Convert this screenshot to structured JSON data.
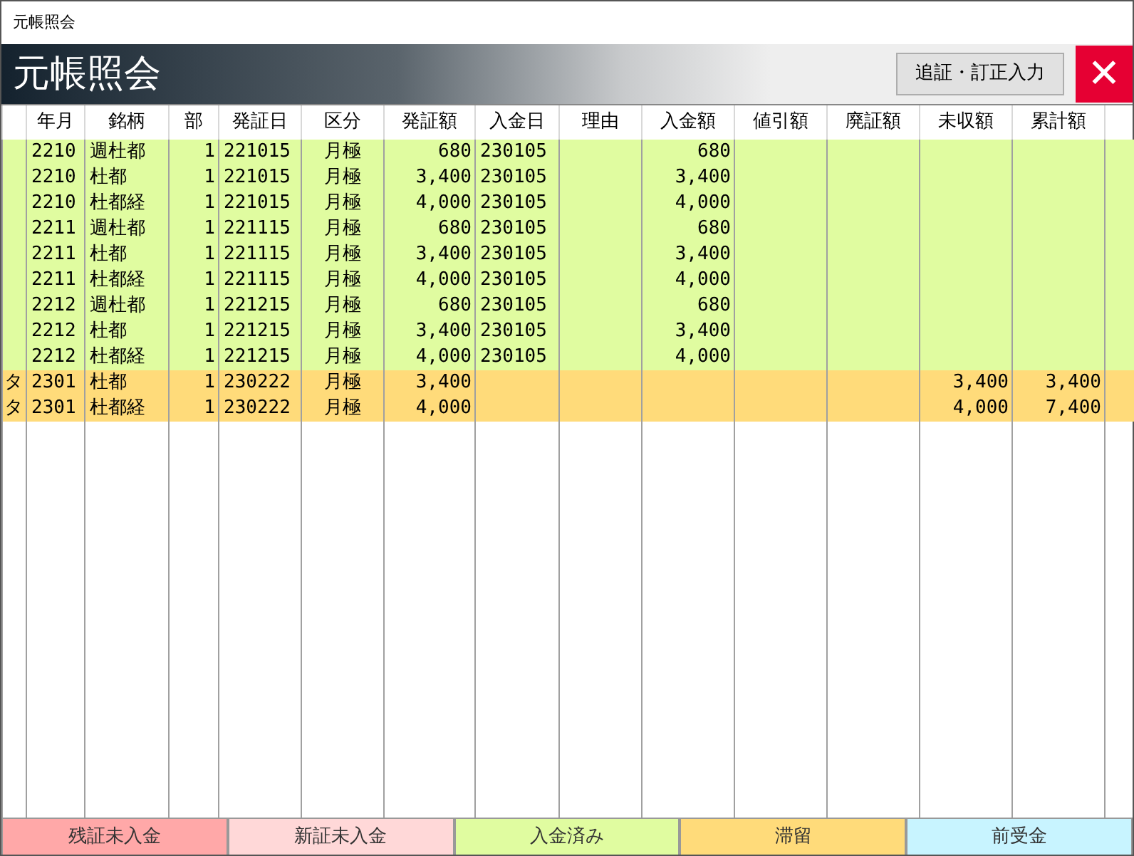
{
  "window": {
    "title": "元帳照会"
  },
  "header": {
    "title": "元帳照会",
    "button": "追証・訂正入力",
    "close": "✕"
  },
  "table": {
    "columns": [
      "",
      "年月",
      "銘柄",
      "部",
      "発証日",
      "区分",
      "発証額",
      "入金日",
      "理由",
      "入金額",
      "値引額",
      "廃証額",
      "未収額",
      "累計額",
      ""
    ],
    "rows": [
      {
        "color": "#e0fca0",
        "cells": [
          "",
          "2210",
          "週杜都",
          "1",
          "221015",
          "月極",
          "680",
          "230105",
          "",
          "680",
          "",
          "",
          "",
          "",
          ""
        ]
      },
      {
        "color": "#e0fca0",
        "cells": [
          "",
          "2210",
          "杜都",
          "1",
          "221015",
          "月極",
          "3,400",
          "230105",
          "",
          "3,400",
          "",
          "",
          "",
          "",
          ""
        ]
      },
      {
        "color": "#e0fca0",
        "cells": [
          "",
          "2210",
          "杜都経",
          "1",
          "221015",
          "月極",
          "4,000",
          "230105",
          "",
          "4,000",
          "",
          "",
          "",
          "",
          ""
        ]
      },
      {
        "color": "#e0fca0",
        "cells": [
          "",
          "2211",
          "週杜都",
          "1",
          "221115",
          "月極",
          "680",
          "230105",
          "",
          "680",
          "",
          "",
          "",
          "",
          ""
        ]
      },
      {
        "color": "#e0fca0",
        "cells": [
          "",
          "2211",
          "杜都",
          "1",
          "221115",
          "月極",
          "3,400",
          "230105",
          "",
          "3,400",
          "",
          "",
          "",
          "",
          ""
        ]
      },
      {
        "color": "#e0fca0",
        "cells": [
          "",
          "2211",
          "杜都経",
          "1",
          "221115",
          "月極",
          "4,000",
          "230105",
          "",
          "4,000",
          "",
          "",
          "",
          "",
          ""
        ]
      },
      {
        "color": "#e0fca0",
        "cells": [
          "",
          "2212",
          "週杜都",
          "1",
          "221215",
          "月極",
          "680",
          "230105",
          "",
          "680",
          "",
          "",
          "",
          "",
          ""
        ]
      },
      {
        "color": "#e0fca0",
        "cells": [
          "",
          "2212",
          "杜都",
          "1",
          "221215",
          "月極",
          "3,400",
          "230105",
          "",
          "3,400",
          "",
          "",
          "",
          "",
          ""
        ]
      },
      {
        "color": "#e0fca0",
        "cells": [
          "",
          "2212",
          "杜都経",
          "1",
          "221215",
          "月極",
          "4,000",
          "230105",
          "",
          "4,000",
          "",
          "",
          "",
          "",
          ""
        ]
      },
      {
        "color": "#ffdb7a",
        "cells": [
          "タ",
          "2301",
          "杜都",
          "1",
          "230222",
          "月極",
          "3,400",
          "",
          "",
          "",
          "",
          "",
          "3,400",
          "3,400",
          ""
        ]
      },
      {
        "color": "#ffdb7a",
        "cells": [
          "タ",
          "2301",
          "杜都経",
          "1",
          "230222",
          "月極",
          "4,000",
          "",
          "",
          "",
          "",
          "",
          "4,000",
          "7,400",
          ""
        ]
      }
    ]
  },
  "legend": [
    {
      "label": "残証未入金",
      "color": "#ffa8a8"
    },
    {
      "label": "新証未入金",
      "color": "#ffd8d8"
    },
    {
      "label": "入金済み",
      "color": "#e0fca0"
    },
    {
      "label": "滞留",
      "color": "#ffdb7a"
    },
    {
      "label": "前受金",
      "color": "#c8f4ff"
    }
  ]
}
